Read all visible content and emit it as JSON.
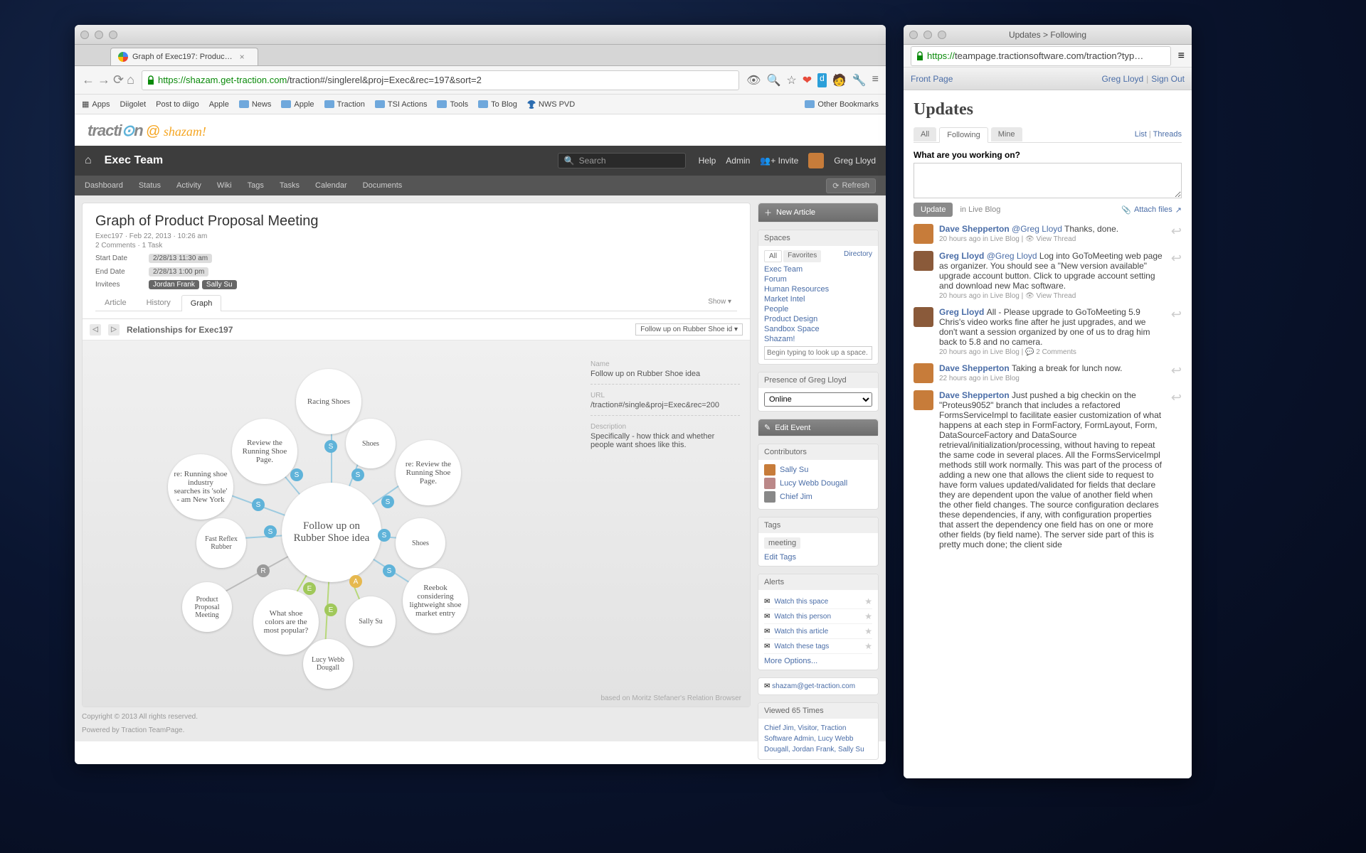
{
  "main_window": {
    "tab_title": "Graph of Exec197: Produc…",
    "url_green": "https://shazam.get-traction.com",
    "url_rest": "/traction#/singlerel&proj=Exec&rec=197&sort=2",
    "bookmarks": [
      "Apps",
      "Diigolet",
      "Post to diigo",
      "Apple",
      "News",
      "Apple",
      "Traction",
      "TSI Actions",
      "Tools",
      "To Blog",
      "NWS PVD",
      "Other Bookmarks"
    ],
    "darkbar": {
      "title": "Exec Team",
      "search_ph": "Search",
      "help": "Help",
      "admin": "Admin",
      "invite": "Invite",
      "user": "Greg Lloyd"
    },
    "menubar": [
      "Dashboard",
      "Status",
      "Activity",
      "Wiki",
      "Tags",
      "Tasks",
      "Calendar",
      "Documents"
    ],
    "refresh": "Refresh",
    "article": {
      "title": "Graph of Product Proposal Meeting",
      "meta1": "Exec197 · Feb 22, 2013 · 10:26 am",
      "meta2": "2 Comments · 1 Task",
      "start_k": "Start Date",
      "start_v": "2/28/13 11:30 am",
      "end_k": "End Date",
      "end_v": "2/28/13 1:00 pm",
      "inv_k": "Invitees",
      "inv1": "Jordan Frank",
      "inv2": "Sally Su"
    },
    "content_tabs": [
      "Article",
      "History",
      "Graph"
    ],
    "show": "Show ▾",
    "graph": {
      "heading": "Relationships for Exec197",
      "select": "Follow up on Rubber Shoe id ▾",
      "center": "Follow up on Rubber Shoe idea",
      "nodes": {
        "racing": "Racing Shoes",
        "review_page": "Review the Running Shoe Page.",
        "shoes1": "Shoes",
        "re_review": "re: Review the Running Shoe Page.",
        "re_running": "re: Running shoe industry searches its 'sole' - am New York",
        "fast_reflex": "Fast Reflex Rubber",
        "shoes2": "Shoes",
        "reebok": "Reebok considering lightweight shoe market entry",
        "sally": "Sally Su",
        "colors": "What shoe colors are the most popular?",
        "lucy": "Lucy Webb Dougall",
        "ppm": "Product Proposal Meeting"
      },
      "info": {
        "name_k": "Name",
        "name_v": "Follow up on Rubber Shoe idea",
        "url_k": "URL",
        "url_v": "/traction#/single&proj=Exec&rec=200",
        "desc_k": "Description",
        "desc_v": "Specifically - how thick and whether people want shoes like this."
      },
      "credits": "based on Moritz Stefaner's Relation Browser"
    },
    "footer1": "Copyright © 2013 All rights reserved.",
    "footer2": "Powered by Traction TeamPage.",
    "sidebar": {
      "new_article": "New Article",
      "spaces_h": "Spaces",
      "space_tabs": {
        "all": "All",
        "fav": "Favorites",
        "dir": "Directory"
      },
      "spaces": [
        "Exec Team",
        "Forum",
        "Human Resources",
        "Market Intel",
        "People",
        "Product Design",
        "Sandbox Space",
        "Shazam!"
      ],
      "space_search_ph": "Begin typing to look up a space.",
      "presence_h": "Presence of Greg Lloyd",
      "presence_v": "Online",
      "edit_event": "Edit Event",
      "contrib_h": "Contributors",
      "contribs": [
        "Sally Su",
        "Lucy Webb Dougall",
        "Chief Jim"
      ],
      "tags_h": "Tags",
      "tag": "meeting",
      "edit_tags": "Edit Tags",
      "alerts_h": "Alerts",
      "alerts": [
        "Watch this space",
        "Watch this person",
        "Watch this article",
        "Watch these tags"
      ],
      "more_opts": "More Options...",
      "email": "shazam@get-traction.com",
      "viewed_h": "Viewed 65 Times",
      "viewers": "Chief Jim, Visitor, Traction Software Admin, Lucy Webb Dougall, Jordan Frank, Sally Su"
    }
  },
  "side_window": {
    "title": "Updates > Following",
    "url_green": "https://",
    "url_rest": "teampage.tractionsoftware.com/traction?typ…",
    "bar": {
      "front": "Front Page",
      "user": "Greg Lloyd",
      "signout": "Sign Out"
    },
    "heading": "Updates",
    "tabs": [
      "All",
      "Following",
      "Mine"
    ],
    "right_links": {
      "list": "List",
      "threads": "Threads"
    },
    "compose_lbl": "What are you working on?",
    "update_btn": "Update",
    "in_live": "in Live Blog",
    "attach": "Attach files",
    "posts": [
      {
        "who": "Dave Shepperton",
        "mention": "@Greg Lloyd",
        "txt": "Thanks, done.",
        "sub": "20 hours ago in Live Blog | 👁 View Thread",
        "av": "#c77c3a"
      },
      {
        "who": "Greg Lloyd",
        "mention": "@Greg Lloyd",
        "txt": "Log into GoToMeeting web page as organizer. You should see a \"New version available\" upgrade account button. Click to upgrade account setting and download new Mac software.",
        "sub": "20 hours ago in Live Blog | 👁 View Thread",
        "av": "#8a5a3a"
      },
      {
        "who": "Greg Lloyd",
        "mention": "",
        "txt": "All - Please upgrade to GoToMeeting 5.9 Chris's video works fine after he just upgrades, and we don't want a session organized by one of us to drag him back to 5.8 and no camera.",
        "sub": "20 hours ago in Live Blog | 💬 2 Comments",
        "av": "#8a5a3a"
      },
      {
        "who": "Dave Shepperton",
        "mention": "",
        "txt": "Taking a break for lunch now.",
        "sub": "22 hours ago in Live Blog",
        "av": "#c77c3a"
      },
      {
        "who": "Dave Shepperton",
        "mention": "",
        "txt": "Just pushed a big checkin on the \"Proteus9052\" branch that includes a refactored FormsServiceImpl to facilitate easier customization of what happens at each step in FormFactory, FormLayout, Form, DataSourceFactory and DataSource retrieval/initialization/processing, without having to repeat the same code in several places. All the FormsServiceImpl methods still work normally.\n\nThis was part of the process of adding a new one that allows the client side to request to have form values updated/validated for fields that declare they are dependent upon the value of another field when the other field changes. The source configuration declares these dependencies, if any, with configuration properties that assert the dependency one field has on one or more other fields (by field name). The server side part of this is pretty much done; the client side",
        "sub": "",
        "av": "#c77c3a"
      }
    ]
  }
}
